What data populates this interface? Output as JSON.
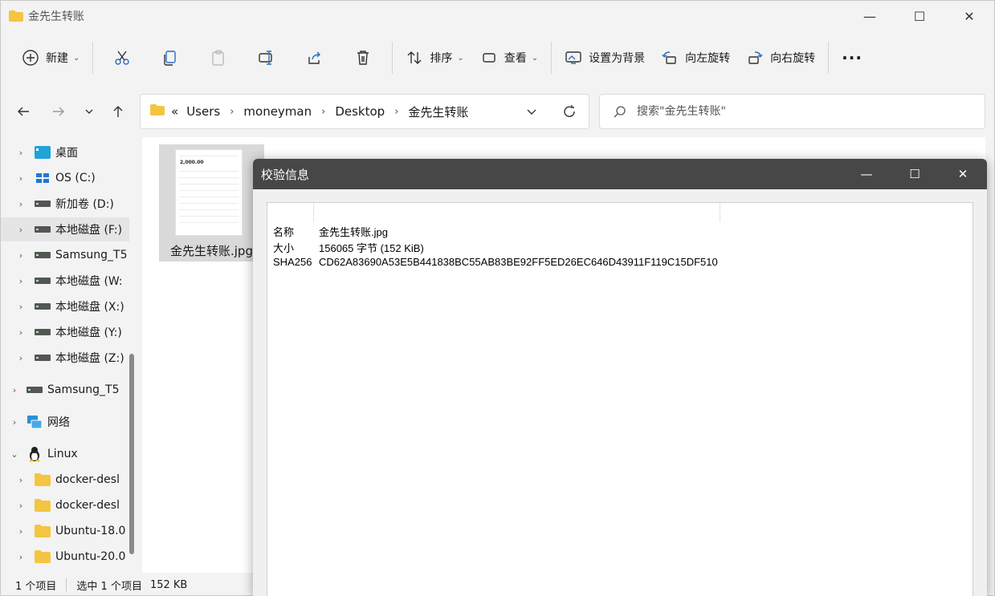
{
  "window": {
    "title": "金先生转账",
    "controls": [
      "—",
      "☐",
      "✕"
    ]
  },
  "toolbar": {
    "new_label": "新建",
    "sort_label": "排序",
    "view_label": "查看",
    "set_bg_label": "设置为背景",
    "rotate_left_label": "向左旋转",
    "rotate_right_label": "向右旋转",
    "more_label": "···"
  },
  "address": {
    "overflow": "«",
    "crumbs": [
      "Users",
      "moneyman",
      "Desktop",
      "金先生转账"
    ],
    "search_placeholder": "搜索\"金先生转账\""
  },
  "sidebar": {
    "items": [
      {
        "label": "桌面",
        "icon": "desktop-icon"
      },
      {
        "label": "OS (C:)",
        "icon": "windows-drive-icon"
      },
      {
        "label": "新加卷 (D:)",
        "icon": "drive-icon"
      },
      {
        "label": "本地磁盘 (F:)",
        "icon": "drive-icon"
      },
      {
        "label": "Samsung_T5",
        "icon": "drive-icon"
      },
      {
        "label": "本地磁盘 (W:",
        "icon": "drive-icon"
      },
      {
        "label": "本地磁盘 (X:)",
        "icon": "drive-icon"
      },
      {
        "label": "本地磁盘 (Y:)",
        "icon": "drive-icon"
      },
      {
        "label": "本地磁盘 (Z:)",
        "icon": "drive-icon"
      },
      {
        "label": "Samsung_T5",
        "icon": "drive-icon"
      },
      {
        "label": "网络",
        "icon": "network-icon"
      },
      {
        "label": "Linux",
        "icon": "linux-icon"
      },
      {
        "label": "docker-desl",
        "icon": "folder-icon"
      },
      {
        "label": "docker-desl",
        "icon": "folder-icon"
      },
      {
        "label": "Ubuntu-18.0",
        "icon": "folder-icon"
      },
      {
        "label": "Ubuntu-20.0",
        "icon": "folder-icon"
      }
    ]
  },
  "content": {
    "file_name": "金先生转账.jpg",
    "thumb_amount": "2,000.00"
  },
  "status": {
    "count": "1 个项目",
    "selected": "选中 1 个项目",
    "size": "152 KB"
  },
  "dialog": {
    "title": "校验信息",
    "controls": [
      "—",
      "☐",
      "✕"
    ],
    "rows": [
      {
        "key": "名称",
        "value": "金先生转账.jpg"
      },
      {
        "key": "大小",
        "value": "156065 字节 (152 KiB)"
      },
      {
        "key": "SHA256",
        "value": "CD62A83690A53E5B441838BC55AB83BE92FF5ED26EC646D43911F119C15DF510"
      }
    ]
  },
  "colors": {
    "folder": "#f4c542",
    "dialog_title_bg": "#474747",
    "selected_bg": "#e5e5e5"
  }
}
